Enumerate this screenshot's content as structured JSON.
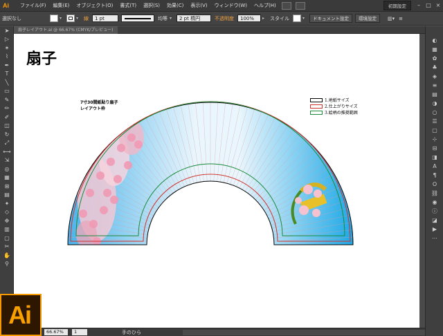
{
  "menubar": {
    "logo": "Ai",
    "items": [
      "ファイル(F)",
      "編集(E)",
      "オブジェクト(O)",
      "書式(T)",
      "選択(S)",
      "効果(C)",
      "表示(V)",
      "ウィンドウ(W)",
      "ヘルプ(H)"
    ],
    "workspace": "初期設定",
    "window_buttons": [
      "–",
      "□",
      "×"
    ]
  },
  "controlbar": {
    "selection_label": "選択なし",
    "stroke_label": "線",
    "stroke_weight": "1 pt",
    "profile_label": "均等",
    "brush_label": "2 pt 楕円",
    "opacity_label": "不透明度",
    "opacity_value": "100%",
    "style_label": "スタイル",
    "doc_setup_button": "ドキュメント設定",
    "env_button": "環境設定"
  },
  "document_tab": {
    "name": "扇子レイアウト.ai @ 66.67% (CMYK/プレビュー)"
  },
  "artboard": {
    "title": "扇子",
    "layout_title_line1": "7寸30間紙貼り扇子",
    "layout_title_line2": "レイアウト枠",
    "legend": [
      {
        "label": "1.地紙サイズ",
        "color": "#000000"
      },
      {
        "label": "2.仕上がりサイズ",
        "color": "#d0302a"
      },
      {
        "label": "3.絵柄の推奨範囲",
        "color": "#1a8a3a"
      }
    ]
  },
  "statusbar": {
    "zoom": "66.67%",
    "page": "1",
    "tool_name": "手のひら"
  },
  "badge": {
    "logo_text": "Ai"
  },
  "tools_left": [
    "selection-tool-icon",
    "direct-selection-tool-icon",
    "magic-wand-icon",
    "lasso-icon",
    "pen-tool-icon",
    "type-tool-icon",
    "line-tool-icon",
    "rectangle-tool-icon",
    "paintbrush-icon",
    "pencil-icon",
    "blob-brush-icon",
    "eraser-icon",
    "rotate-icon",
    "scale-icon",
    "width-icon",
    "free-transform-icon",
    "shape-builder-icon",
    "perspective-icon",
    "mesh-icon",
    "gradient-icon",
    "eyedropper-icon",
    "blend-icon",
    "symbol-sprayer-icon",
    "column-graph-icon",
    "artboard-icon",
    "slice-icon",
    "hand-icon",
    "zoom-icon"
  ],
  "tools_right": [
    "color-panel-icon",
    "swatches-icon",
    "brushes-icon",
    "symbols-icon",
    "graphic-styles-icon",
    "stroke-icon",
    "gradient-panel-icon",
    "transparency-icon",
    "appearance-icon",
    "layers-icon",
    "artboards-icon",
    "transform-icon",
    "align-icon",
    "pathfinder-icon",
    "character-icon",
    "paragraph-icon",
    "opentype-icon",
    "links-icon",
    "navigator-icon",
    "info-icon",
    "attributes-icon",
    "actions-icon",
    "variables-icon"
  ]
}
